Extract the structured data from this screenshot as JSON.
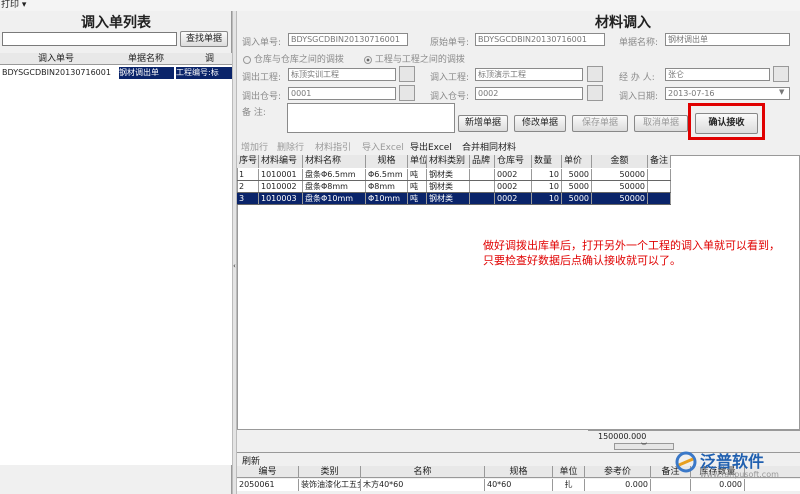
{
  "menu": {
    "print": "打印 ▾"
  },
  "left": {
    "title": "调入单列表",
    "search_button": "查找单据",
    "search_value": "",
    "columns": [
      "调入单号",
      "单据名称",
      "调"
    ],
    "rows": [
      [
        "BDYSGCDBIN20130716001",
        "钢材调出单",
        "工程编号:标"
      ]
    ]
  },
  "form": {
    "title": "材料调入",
    "in_no_label": "调入单号:",
    "in_no": "BDYSGCDBIN20130716001",
    "orig_no_label": "原始单号:",
    "orig_no": "BDYSGCDBIN20130716001",
    "doc_name_label": "单据名称:",
    "doc_name": "钢材调出单",
    "radio1": "仓库与仓库之间的调拨",
    "radio2": "工程与工程之间的调拨",
    "out_proj_label": "调出工程:",
    "out_proj": "标顶实训工程",
    "in_proj_label": "调入工程:",
    "in_proj": "标顶演示工程",
    "handler_label": "经 办 人:",
    "handler": "张仑",
    "out_wh_label": "调出仓号:",
    "out_wh": "0001",
    "in_wh_label": "调入仓号:",
    "in_wh": "0002",
    "date_label": "调入日期:",
    "date": "2013-07-16",
    "remark_label": "备    注:",
    "btn_new": "新增单据",
    "btn_edit": "修改单据",
    "btn_save": "保存单据",
    "btn_cancel": "取消单据",
    "btn_confirm": "确认接收"
  },
  "toolbar": {
    "add": "增加行",
    "del": "删除行",
    "guide": "材料指引",
    "import": "导入Excel",
    "export": "导出Excel",
    "merge": "合并相同材料"
  },
  "grid": {
    "columns": [
      "序号",
      "材料编号",
      "材料名称",
      "规格",
      "单位",
      "材料类别",
      "品牌",
      "仓库号",
      "数量",
      "单价",
      "金额",
      "备注"
    ],
    "rows": [
      [
        "1",
        "1010001",
        "盘条Φ6.5mm",
        "Φ6.5mm",
        "吨",
        "钢材类",
        "",
        "0002",
        "10",
        "5000",
        "50000",
        ""
      ],
      [
        "2",
        "1010002",
        "盘条Φ8mm",
        "Φ8mm",
        "吨",
        "钢材类",
        "",
        "0002",
        "10",
        "5000",
        "50000",
        ""
      ],
      [
        "3",
        "1010003",
        "盘条Φ10mm",
        "Φ10mm",
        "吨",
        "钢材类",
        "",
        "0002",
        "10",
        "5000",
        "50000",
        ""
      ]
    ],
    "total": "150000.000"
  },
  "note": "做好调拨出库单后，打开另外一个工程的调入单就可以看到，只要检查好数据后点确认接收就可以了。",
  "bottom": {
    "refresh": "刷新",
    "columns": [
      "编号",
      "类别",
      "名称",
      "规格",
      "单位",
      "参考价",
      "备注",
      "库存数量"
    ],
    "row": [
      "2050061",
      "装饰油漆化工五金",
      "木方40*60",
      "40*60",
      "扎",
      "0.000",
      "",
      "0.000"
    ]
  },
  "logo": {
    "text": "泛普软件",
    "sub": "www.fanpusoft.com"
  },
  "colors": {
    "selection": "#0a246a",
    "highlight": "#e00000",
    "note": "#e00000"
  }
}
